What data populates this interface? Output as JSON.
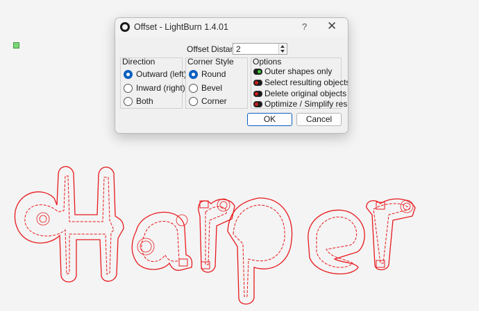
{
  "dialog": {
    "title": "Offset - LightBurn 1.4.01",
    "help_label": "?",
    "close_label": "✕",
    "offset_distance_label": "Offset Distance",
    "offset_distance_value": "2",
    "direction": {
      "title": "Direction",
      "options": [
        {
          "label": "Outward (left)",
          "checked": true
        },
        {
          "label": "Inward (right)",
          "checked": false
        },
        {
          "label": "Both",
          "checked": false
        }
      ]
    },
    "corner_style": {
      "title": "Corner Style",
      "options": [
        {
          "label": "Round",
          "checked": true
        },
        {
          "label": "Bevel",
          "checked": false
        },
        {
          "label": "Corner",
          "checked": false
        }
      ]
    },
    "options": {
      "title": "Options",
      "items": [
        {
          "label": "Outer shapes only",
          "on": true
        },
        {
          "label": "Select resulting objects",
          "on": false
        },
        {
          "label": "Delete original objects",
          "on": false
        },
        {
          "label": "Optimize / Simplify results",
          "on": false
        }
      ]
    },
    "ok_label": "OK",
    "cancel_label": "Cancel"
  },
  "canvas": {
    "design_text": "Harper",
    "stroke_color": "#e8171b",
    "background": "#f4f4f4"
  },
  "icons": [
    "app-icon",
    "help-icon",
    "close-icon",
    "spin-up-icon",
    "spin-down-icon",
    "selection-handle-icon"
  ]
}
